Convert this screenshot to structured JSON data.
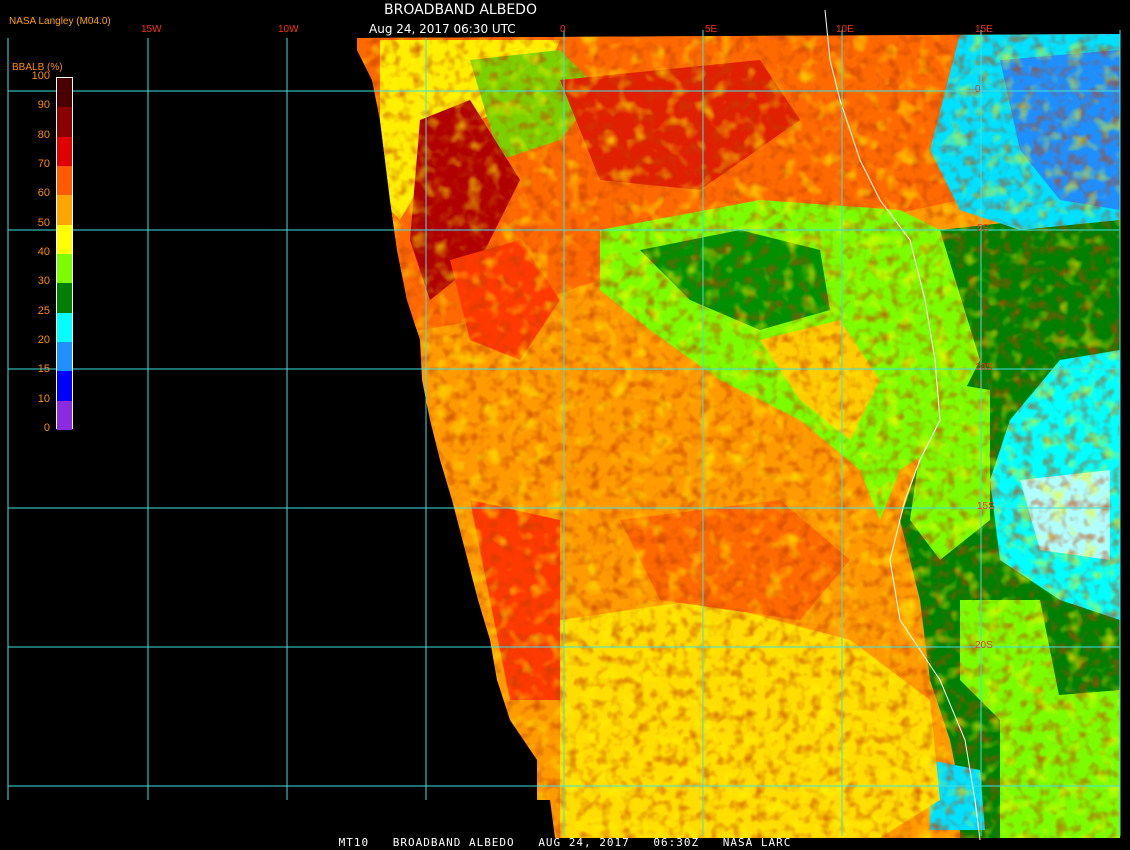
{
  "header": {
    "title": "BROADBAND ALBEDO",
    "datetime": "Aug 24, 2017 06:30 UTC",
    "producer": "NASA Langley (M04.0)"
  },
  "footer": {
    "instrument": "MT10",
    "product": "BROADBAND ALBEDO",
    "date": "AUG 24, 2017",
    "time": "06:30Z",
    "source": "NASA LARC"
  },
  "colorbar": {
    "label": "BBALB (%)",
    "ticks": [
      "100",
      "90",
      "80",
      "70",
      "60",
      "50",
      "40",
      "30",
      "25",
      "20",
      "15",
      "10",
      "0"
    ],
    "colors": [
      "#4a0000",
      "#8b0000",
      "#e00000",
      "#ff5a00",
      "#ffa500",
      "#ffff00",
      "#7cfc00",
      "#008000",
      "#00ffff",
      "#1e90ff",
      "#0000ff",
      "#8a2be2"
    ]
  },
  "grid": {
    "longitude_labels": [
      "15W",
      "10W",
      "0",
      "5E",
      "10E",
      "15E"
    ],
    "latitude_labels": [
      "0",
      "5S",
      "10S",
      "15S",
      "20S"
    ]
  }
}
